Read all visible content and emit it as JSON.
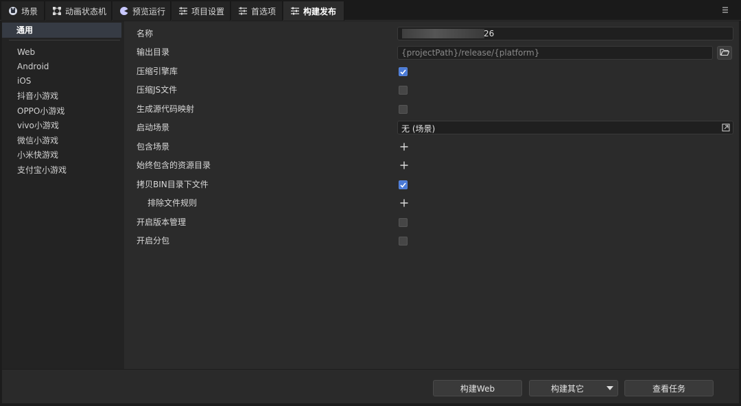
{
  "tabs": [
    {
      "label": "场景",
      "icon": "scene-icon"
    },
    {
      "label": "动画状态机",
      "icon": "state-machine-icon"
    },
    {
      "label": "预览运行",
      "icon": "preview-icon"
    },
    {
      "label": "项目设置",
      "icon": "sliders-icon"
    },
    {
      "label": "首选项",
      "icon": "sliders-icon"
    },
    {
      "label": "构建发布",
      "icon": "sliders-icon",
      "active": true
    }
  ],
  "sidebar": {
    "general": "通用",
    "platforms": [
      "Web",
      "Android",
      "iOS",
      "抖音小游戏",
      "OPPO小游戏",
      "vivo小游戏",
      "微信小游戏",
      "小米快游戏",
      "支付宝小游戏"
    ]
  },
  "settings": {
    "name_label": "名称",
    "name_value": "26",
    "output_label": "输出目录",
    "output_placeholder": "{projectPath}/release/{platform}",
    "compress_engine_label": "压缩引擎库",
    "compress_engine_checked": true,
    "compress_js_label": "压缩JS文件",
    "compress_js_checked": false,
    "source_map_label": "生成源代码映射",
    "source_map_checked": false,
    "start_scene_label": "启动场景",
    "start_scene_value": "无 (场景)",
    "include_scenes_label": "包含场景",
    "always_include_label": "始终包含的资源目录",
    "copy_bin_label": "拷贝BIN目录下文件",
    "copy_bin_checked": true,
    "exclude_rules_label": "排除文件规则",
    "version_mgmt_label": "开启版本管理",
    "version_mgmt_checked": false,
    "subpackage_label": "开启分包",
    "subpackage_checked": false
  },
  "buttons": {
    "build_web": "构建Web",
    "build_other": "构建其它",
    "view_tasks": "查看任务"
  },
  "colors": {
    "accent": "#4a7ad6",
    "selected_bg": "#363b44"
  }
}
